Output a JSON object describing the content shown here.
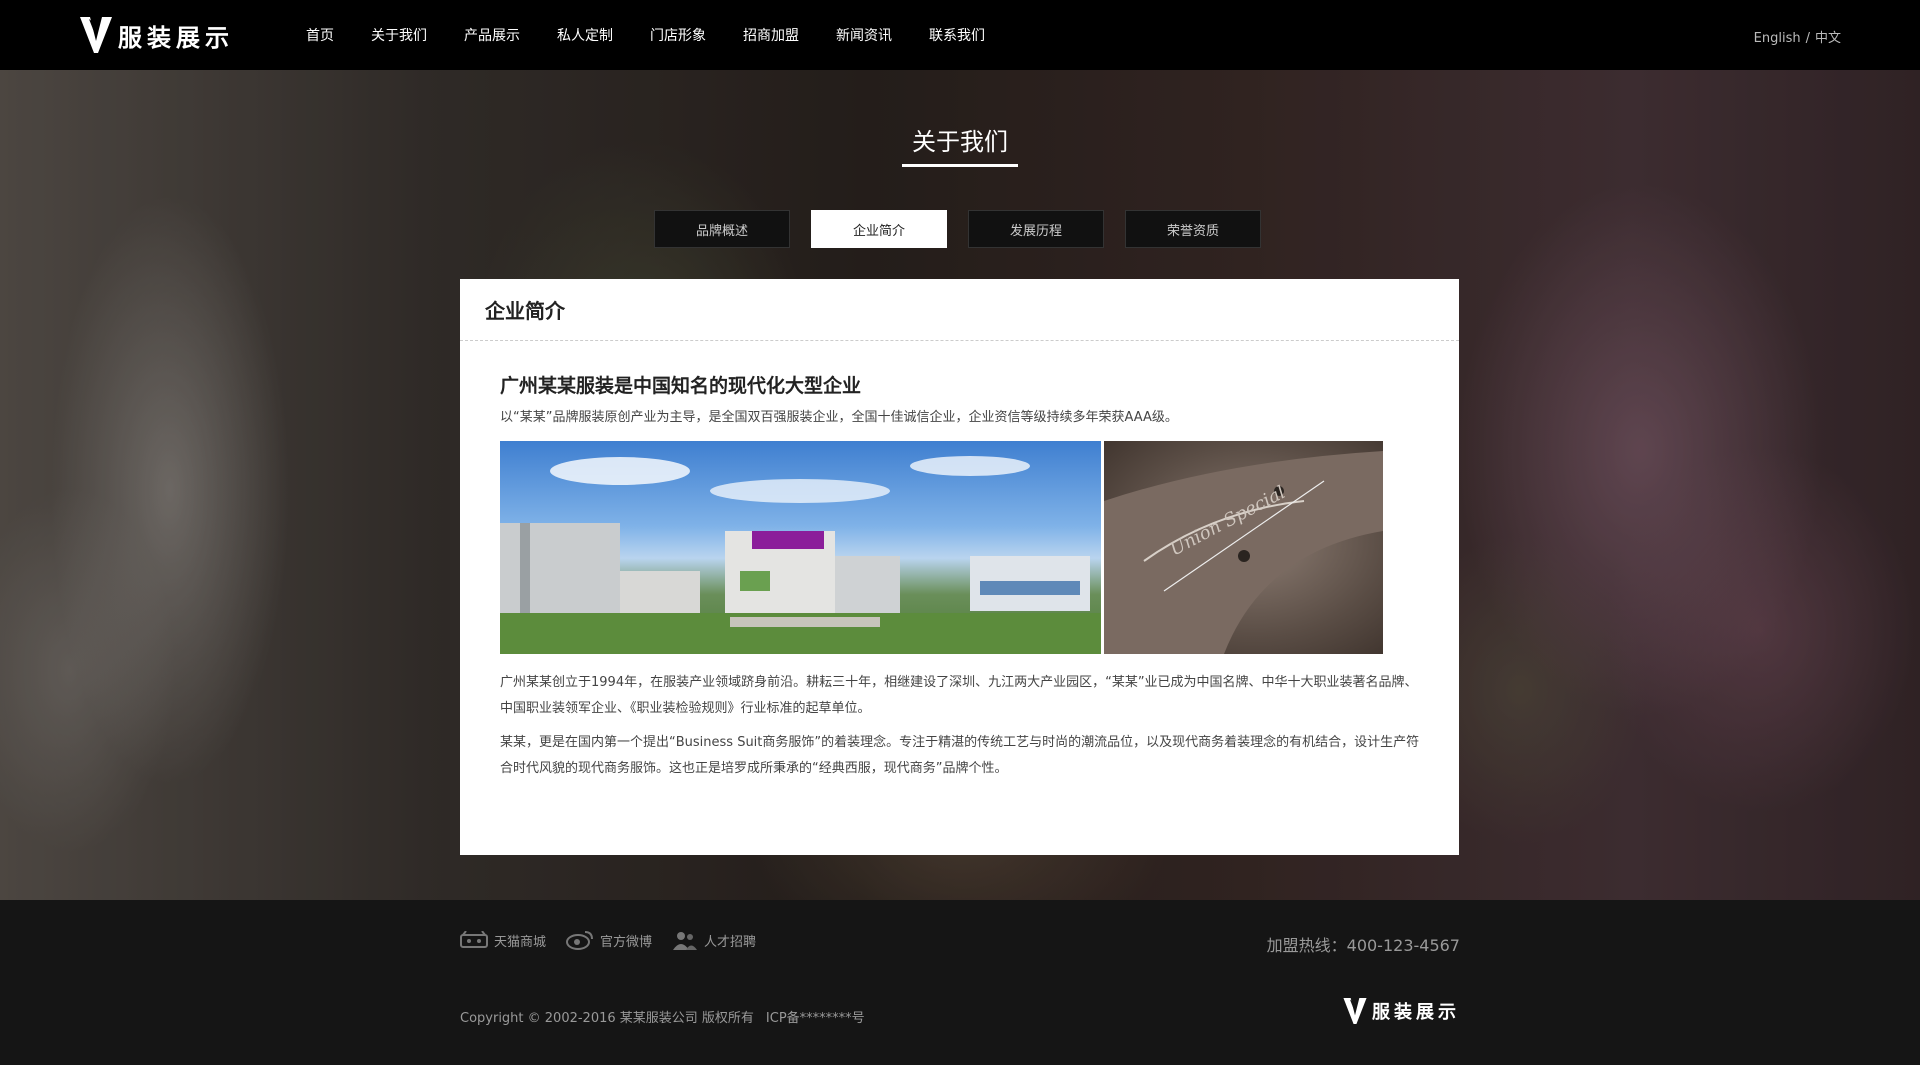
{
  "header": {
    "logo_text": "服装展示",
    "nav": [
      "首页",
      "关于我们",
      "产品展示",
      "私人定制",
      "门店形象",
      "招商加盟",
      "新闻资讯",
      "联系我们"
    ],
    "lang": {
      "english": "English",
      "separator": "/",
      "chinese": "中文"
    }
  },
  "hero": {
    "title": "关于我们",
    "tabs": [
      "品牌概述",
      "企业简介",
      "发展历程",
      "荣誉资质"
    ],
    "active_tab": "企业简介"
  },
  "card": {
    "heading": "企业简介",
    "headline": "广州某某服装是中国知名的现代化大型企业",
    "intro": "以“某某”品牌服装原创产业为主导，是全国双百强服装企业，全国十佳诚信企业，企业资信等级持续多年荣获AAA级。",
    "photos": [
      "factory-campus-photo",
      "sewing-machine-photo"
    ],
    "paragraphs": [
      "广州某某创立于1994年，在服装产业领域跻身前沿。耕耘三十年，相继建设了深圳、九江两大产业园区，“某某”业已成为中国名牌、中华十大职业装著名品牌、中国职业装领军企业、《职业装检验规则》行业标准的起草单位。",
      "某某，更是在国内第一个提出“Business Suit商务服饰”的着装理念。专注于精湛的传统工艺与时尚的潮流品位，以及现代商务着装理念的有机结合，设计生产符合时代风貌的现代商务服饰。这也正是培罗成所秉承的“经典西服，现代商务”品牌个性。"
    ]
  },
  "footer": {
    "links": [
      {
        "label": "天猫商城",
        "icon": "tmall-icon"
      },
      {
        "label": "官方微博",
        "icon": "weibo-icon"
      },
      {
        "label": "人才招聘",
        "icon": "people-icon"
      }
    ],
    "hotline": "加盟热线：400-123-4567",
    "copyright": "Copyright © 2002-2016 某某服装公司 版权所有",
    "icp": "ICP备********号",
    "logo_text": "服装展示"
  }
}
